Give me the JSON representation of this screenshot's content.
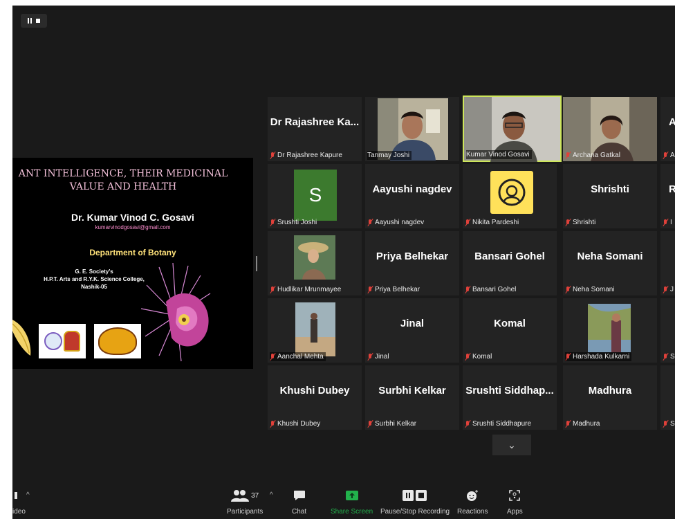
{
  "slide": {
    "title_line1": "ANT INTELLIGENCE, THEIR MEDICINAL",
    "title_line2": "VALUE AND HEALTH",
    "presenter": "Dr. Kumar Vinod C. Gosavi",
    "email": "kumarvinodgosavi@gmail.com",
    "department": "Department of Botany",
    "society": "G. E. Society’s",
    "college": "H.P.T. Arts and R.Y.K. Science College,",
    "city": "Nashik-05"
  },
  "tiles": [
    {
      "center_text": "Dr Rajashree Ka...",
      "label": "Dr Rajashree Kapure"
    },
    {
      "label": "Tanmay Joshi"
    },
    {
      "label": "Kumar Vinod Gosavi"
    },
    {
      "label": "Archana Gatkal"
    },
    {
      "center_text": "A",
      "label": "A"
    },
    {
      "avatar_letter": "S",
      "label": "Srushti Joshi"
    },
    {
      "center_text": "Aayushi nagdev",
      "label": "Aayushi nagdev"
    },
    {
      "label": "Nikita Pardeshi"
    },
    {
      "center_text": "Shrishti",
      "label": "Shrishti"
    },
    {
      "center_text": "R",
      "label": "I"
    },
    {
      "label": "Hudlikar Mrunmayee"
    },
    {
      "center_text": "Priya Belhekar",
      "label": "Priya Belhekar"
    },
    {
      "center_text": "Bansari Gohel",
      "label": "Bansari Gohel"
    },
    {
      "center_text": "Neha Somani",
      "label": "Neha Somani"
    },
    {
      "label": "J"
    },
    {
      "label": "Aanchal Mehta"
    },
    {
      "center_text": "Jinal",
      "label": "Jinal"
    },
    {
      "center_text": "Komal",
      "label": "Komal"
    },
    {
      "label": "Harshada Kulkarni"
    },
    {
      "label": "S"
    },
    {
      "center_text": "Khushi Dubey",
      "label": "Khushi Dubey"
    },
    {
      "center_text": "Surbhi Kelkar",
      "label": "Surbhi Kelkar"
    },
    {
      "center_text": "Srushti Siddhap...",
      "label": "Srushti Siddhapure"
    },
    {
      "center_text": "Madhura",
      "label": "Madhura"
    },
    {
      "label": "S"
    }
  ],
  "toolbar": {
    "video_label": "ideo",
    "participants_count": "37",
    "participants_label": "Participants",
    "chat_label": "Chat",
    "share_label": "Share Screen",
    "record_label": "Pause/Stop Recording",
    "reactions_label": "Reactions",
    "apps_label": "Apps"
  },
  "colors": {
    "background": "#1a1a1a",
    "tile": "#232323",
    "active_speaker_border": "#cde65b",
    "share_screen_green": "#22b24c",
    "muted_red": "#e0413a"
  },
  "icons": [
    "pause-icon",
    "stop-icon",
    "mic-muted-icon",
    "chevron-down-icon",
    "participants-icon",
    "chat-icon",
    "share-screen-icon",
    "record-icon",
    "reactions-icon",
    "apps-icon",
    "caret-up-icon"
  ]
}
